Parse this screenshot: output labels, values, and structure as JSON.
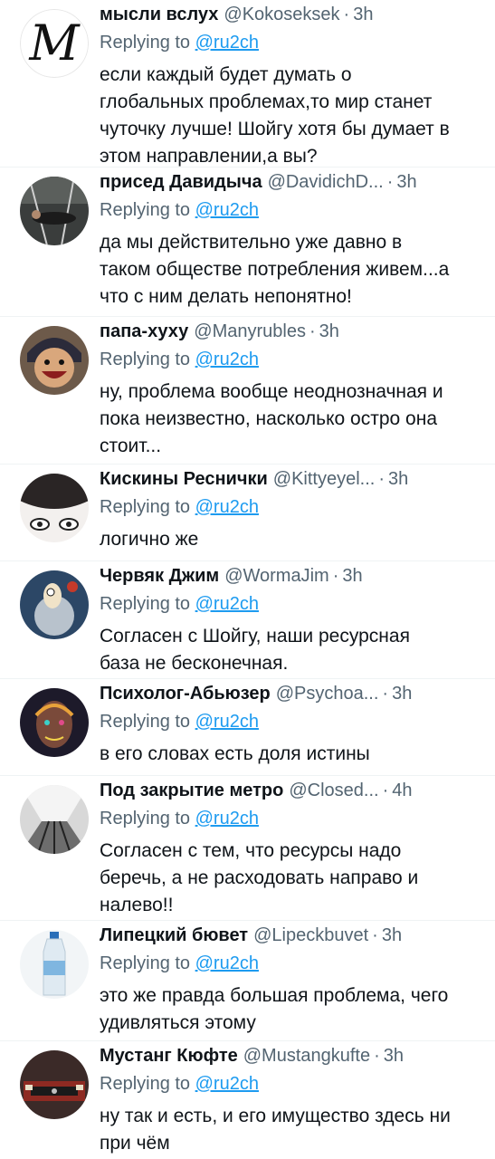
{
  "reply_prefix": "Replying to",
  "reply_target": "@ru2ch",
  "tweets": [
    {
      "name": "мысли вслух",
      "handle": "@Kokoseksek",
      "time": "3h",
      "text": "если каждый будет думать о\nглобальных проблемах,то мир станет\nчуточку лучше! Шойгу хотя бы думает в\nэтом направлении,а вы?"
    },
    {
      "name": "присед Давидыча",
      "handle": "@DavidichD...",
      "time": "3h",
      "text": "да мы действительно уже давно в\nтаком обществе потребления живем...а\nчто с ним делать непонятно!"
    },
    {
      "name": "папа-хуху",
      "handle": "@Manyrubles",
      "time": "3h",
      "text": "ну, проблема вообще неоднозначная и\nпока неизвестно, насколько остро она\nстоит..."
    },
    {
      "name": "Кискины Реснички",
      "handle": "@Kittyeyel...",
      "time": "3h",
      "text": "логично же"
    },
    {
      "name": "Червяк Джим",
      "handle": "@WormaJim",
      "time": "3h",
      "text": "Согласен с Шойгу, наши ресурсная\nбаза не бесконечная."
    },
    {
      "name": "Психолог-Абьюзер",
      "handle": "@Psychoa...",
      "time": "3h",
      "text": "в его словах есть доля истины"
    },
    {
      "name": "Под закрытие метро",
      "handle": "@Closed...",
      "time": "4h",
      "text": "Согласен с тем, что ресурсы надо\nберечь, а не расходовать направо и\nналево!!"
    },
    {
      "name": "Липецкий бювет",
      "handle": "@Lipeckbuvet",
      "time": "3h",
      "text": "это же правда большая проблема, чего\nудивляться этому"
    },
    {
      "name": "Мустанг Кюфте",
      "handle": "@Mustangkufte",
      "time": "3h",
      "text": "ну так и есть, и его имущество здесь ни\nпри чём"
    }
  ],
  "avatars": [
    {
      "icon": "letter-m-avatar",
      "letter": "M"
    },
    {
      "icon": "photo-person-floor-avatar"
    },
    {
      "icon": "cartoon-character-avatar"
    },
    {
      "icon": "eyelashes-avatar"
    },
    {
      "icon": "earthworm-jim-avatar"
    },
    {
      "icon": "colorful-portrait-avatar"
    },
    {
      "icon": "metro-escalator-avatar"
    },
    {
      "icon": "water-bottle-avatar"
    },
    {
      "icon": "mustang-car-avatar"
    }
  ]
}
